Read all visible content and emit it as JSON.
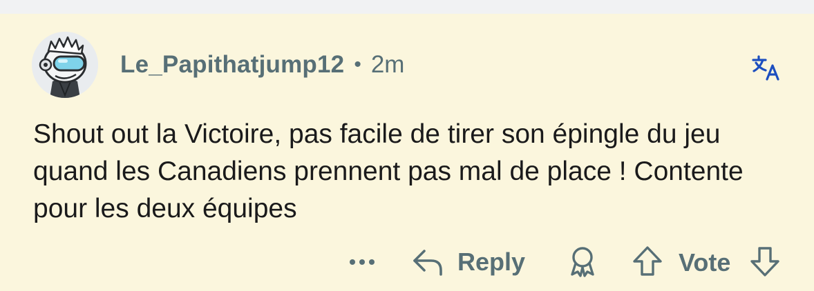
{
  "comment": {
    "author": "Le_Papithatjump12",
    "separator": "•",
    "time": "2m",
    "body": "Shout out la Victoire, pas facile de tirer son épingle du jeu quand les Canadiens prennent pas mal de place ! Contente pour les deux équipes"
  },
  "actions": {
    "reply_label": "Reply",
    "vote_label": "Vote"
  },
  "icons": {
    "translate": "translate-icon",
    "more": "more-dots-icon",
    "reply": "reply-arrow-icon",
    "award": "award-icon",
    "upvote": "upvote-arrow-icon",
    "downvote": "downvote-arrow-icon"
  },
  "colors": {
    "background": "#fbf6dd",
    "meta_text": "#576f76",
    "body_text": "#1a1a1b",
    "accent": "#1d4fbf"
  }
}
